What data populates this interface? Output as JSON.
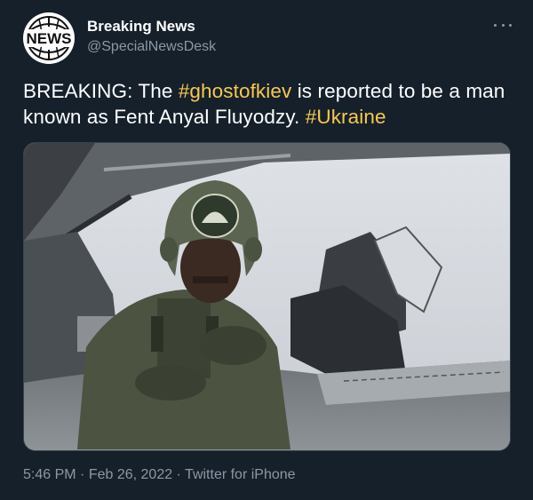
{
  "tweet": {
    "avatar_text": "NEWS",
    "display_name": "Breaking News",
    "handle": "@SpecialNewsDesk",
    "text": {
      "part1": "BREAKING: The ",
      "hashtag1": "#ghostofkiev",
      "part2": " is reported to be a man known as Fent Anyal Fluyodzy. ",
      "hashtag2": "#Ukraine"
    },
    "time": "5:46 PM",
    "separator": " · ",
    "date": "Feb 26, 2022",
    "source": "Twitter for iPhone",
    "more_icon": "ellipsis-icon",
    "media_icon": "photo-fighter-pilot-cockpit"
  },
  "colors": {
    "background": "#15202b",
    "hashtag": "#f7c94d",
    "secondary_text": "#8b98a5",
    "border": "#38444d"
  }
}
